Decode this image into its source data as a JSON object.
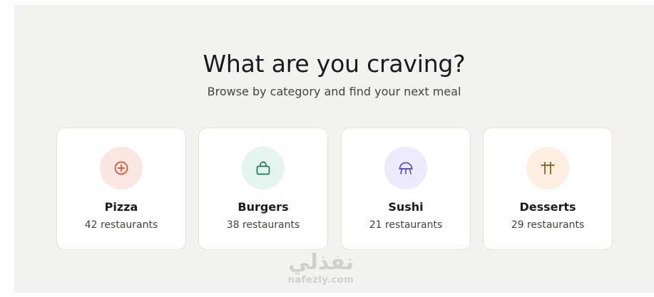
{
  "header": {
    "title": "What are you craving?",
    "subtitle": "Browse by category and find your next meal"
  },
  "categories": [
    {
      "name": "Pizza",
      "count": "42 restaurants",
      "icon": "pizza-icon",
      "bg": "#fbe7e2",
      "color": "#d9532e"
    },
    {
      "name": "Burgers",
      "count": "38 restaurants",
      "icon": "bag-icon",
      "bg": "#e3f5ed",
      "color": "#1f7a52"
    },
    {
      "name": "Sushi",
      "count": "21 restaurants",
      "icon": "sushi-icon",
      "bg": "#ecebfb",
      "color": "#5b4fc9"
    },
    {
      "name": "Desserts",
      "count": "29 restaurants",
      "icon": "dessert-icon",
      "bg": "#fcefdf",
      "color": "#8a5a1c"
    }
  ],
  "watermark": {
    "arabic": "نفذلي",
    "latin": "nafezly.com"
  }
}
